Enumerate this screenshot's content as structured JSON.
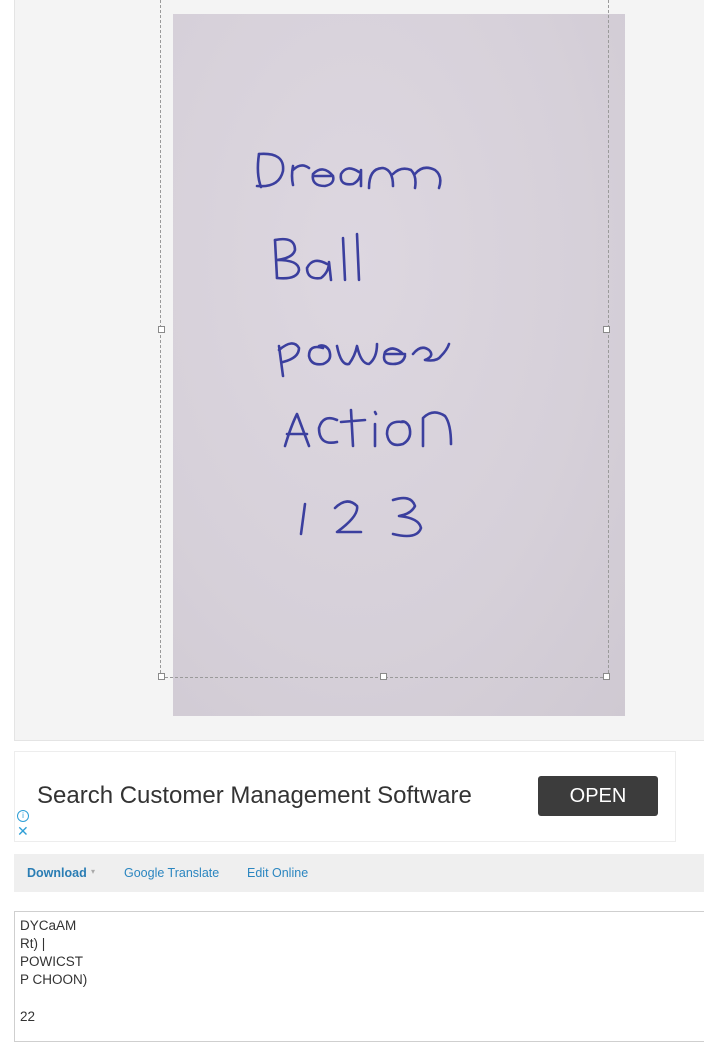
{
  "image_preview": {
    "handwriting_lines": [
      "Dream",
      "Ball",
      "power",
      "Action",
      "123"
    ]
  },
  "ad": {
    "headline": "Search Customer Management Software",
    "cta": "OPEN",
    "info_glyph": "i",
    "close_glyph": "✕"
  },
  "toolbar": {
    "download": "Download",
    "caret": "▾",
    "google_translate": "Google Translate",
    "edit_online": "Edit Online"
  },
  "ocr_output": {
    "lines": [
      "DYCaAM",
      "Rt) |",
      "POWICST",
      "P CHOON)",
      "",
      "22"
    ]
  },
  "colors": {
    "link_blue": "#2b86c0",
    "ink_blue": "#3b3f9e",
    "ad_button": "#3c3c3c"
  }
}
